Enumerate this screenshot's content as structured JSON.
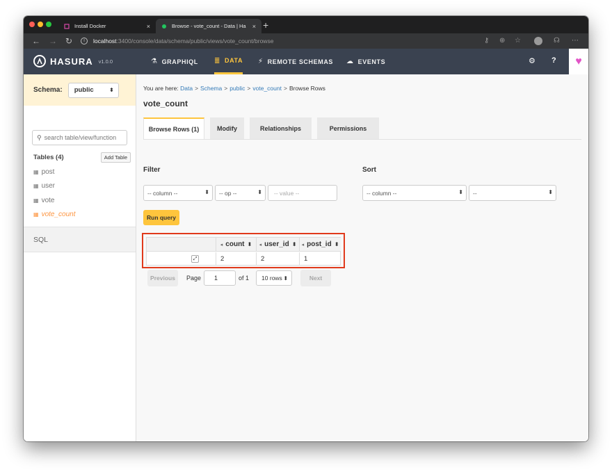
{
  "browser": {
    "tabs": [
      {
        "title": "Install Docker",
        "close": "×"
      },
      {
        "title": "Browse - vote_count - Data | Ha",
        "close": "×"
      }
    ],
    "new_tab": "+",
    "address": {
      "host": "localhost",
      "rest": ":3400/console/data/schema/public/views/vote_count/browse"
    },
    "nav": {
      "back": "←",
      "forward": "→",
      "reload": "↻",
      "info": "i"
    },
    "toolbar": {
      "key": "⚷",
      "zoom": "⊕",
      "star": "☆",
      "cast": "☊",
      "more": "⋯"
    },
    "colors": {
      "close": "#fe5f57",
      "minimize": "#febc2e",
      "maximize": "#28c840"
    }
  },
  "navbar": {
    "brand": "HASURA",
    "version": "v1.0.0",
    "items": [
      {
        "label": "GRAPHIQL",
        "icon": "flask-icon",
        "glyph": "⚗"
      },
      {
        "label": "DATA",
        "icon": "database-icon",
        "glyph": "≣"
      },
      {
        "label": "REMOTE SCHEMAS",
        "icon": "plug-icon",
        "glyph": "⚡"
      },
      {
        "label": "EVENTS",
        "icon": "cloud-icon",
        "glyph": "☁"
      }
    ],
    "settings_glyph": "⚙",
    "help_glyph": "?",
    "heart_glyph": "♥",
    "accent": "#fec53d"
  },
  "sidebar": {
    "schema_label": "Schema:",
    "schema_value": "public",
    "search_placeholder": "search table/view/function",
    "tables_label": "Tables (4)",
    "add_table": "Add Table",
    "tables": [
      "post",
      "user",
      "vote",
      "vote_count"
    ],
    "sql": "SQL"
  },
  "main": {
    "breadcrumb": {
      "prefix": "You are here:",
      "items": [
        "Data",
        "Schema",
        "public",
        "vote_count"
      ],
      "current": "Browse Rows",
      "sep": ">"
    },
    "title": "vote_count",
    "tabs": [
      "Browse Rows (1)",
      "Modify",
      "Relationships",
      "Permissions"
    ],
    "filter": {
      "label": "Filter",
      "column": "-- column --",
      "op": "-- op --",
      "value_placeholder": "-- value --"
    },
    "sort": {
      "label": "Sort",
      "column": "-- column --",
      "order": "--"
    },
    "run_query": "Run query",
    "grid": {
      "headers": [
        "count",
        "user_id",
        "post_id"
      ],
      "rows": [
        [
          "2",
          "2",
          "1"
        ]
      ],
      "expand_glyph": "⤢"
    },
    "pagination": {
      "previous": "Previous",
      "page_label": "Page",
      "page": "1",
      "of": "of 1",
      "rows": "10 rows",
      "next": "Next"
    }
  }
}
